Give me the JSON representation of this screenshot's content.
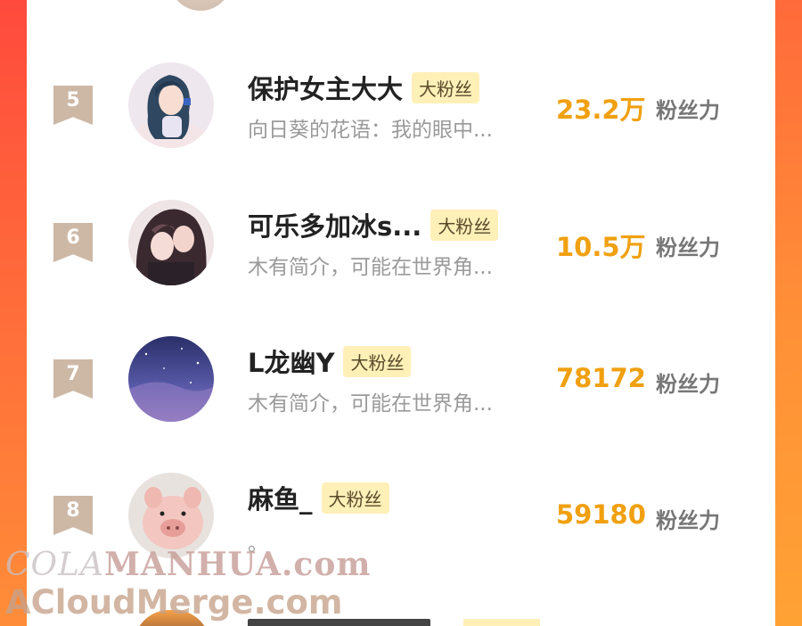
{
  "ranking": {
    "rows": [
      {
        "rank": "5",
        "name": "保护女主大大",
        "badge": "大粉丝",
        "desc": "向日葵的花语：我的眼中...",
        "score": "23.2万",
        "unit": "粉丝力"
      },
      {
        "rank": "6",
        "name": "可乐多加冰s...",
        "badge": "大粉丝",
        "desc": "木有简介，可能在世界角...",
        "score": "10.5万",
        "unit": "粉丝力"
      },
      {
        "rank": "7",
        "name": "L龙幽Y",
        "badge": "大粉丝",
        "desc": "木有简介，可能在世界角...",
        "score": "78172",
        "unit": "粉丝力"
      },
      {
        "rank": "8",
        "name": "麻鱼_",
        "badge": "大粉丝",
        "desc": "。",
        "score": "59180",
        "unit": "粉丝力"
      }
    ]
  },
  "watermark": {
    "line1_prefix": "COLA",
    "line1_rest": "MANHUA.com",
    "line2": "ACloudMerge.com"
  },
  "colors": {
    "accent_score": "#f0a010",
    "badge_bg": "#fff0b8",
    "rank_badge": "#cdb8a6",
    "frame_gradient_top": "#ff4a3d",
    "frame_gradient_bottom": "#ffa234"
  },
  "icons": {
    "rank_marker": "bookmark-ribbon-icon"
  }
}
